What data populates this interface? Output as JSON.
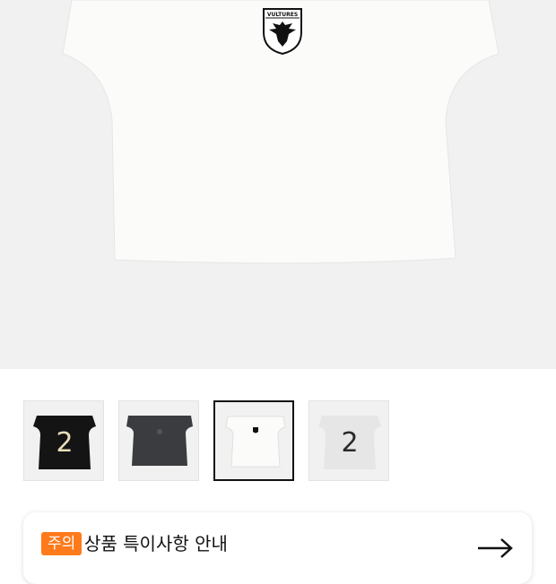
{
  "hero": {
    "logo_text": "VULTURES"
  },
  "thumbnails": [
    {
      "name": "black-jersey",
      "number": "2",
      "selected": false
    },
    {
      "name": "charcoal-jersey",
      "number": "",
      "selected": false
    },
    {
      "name": "white-crest-jersey",
      "number": "",
      "selected": true
    },
    {
      "name": "white-number-jersey",
      "number": "2",
      "selected": false
    }
  ],
  "notice": {
    "badge": "주의",
    "title": "상품 특이사항 안내",
    "arrow_icon": "arrow-right-icon"
  },
  "colors": {
    "badge": "#ff7a1a",
    "background": "#f1f1f1"
  }
}
